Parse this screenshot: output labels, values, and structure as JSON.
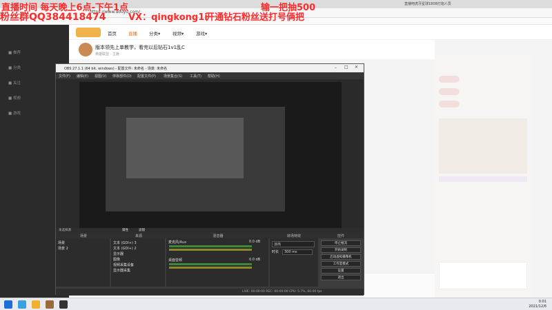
{
  "browser": {
    "url": "https://www.douyu.com/",
    "tab_right_title": "直播吧虎牙星球1808打炮人员"
  },
  "overlays": {
    "line1_left": "直播时间 每天晚上6点-下午1点",
    "line1_right": "输一把抽500",
    "line2_left": "粉丝群QQ384418474",
    "line2_mid": "VX：qingkong1i",
    "line2_right": "开通钻石粉丝送打号俩把"
  },
  "site_nav": {
    "items": [
      "首页",
      "直播",
      "分类▾",
      "视频▾",
      "游戏▾"
    ]
  },
  "stream": {
    "title": "版本领先上单教学，看完以后钻石1v1乱C",
    "subtitle": "英雄联盟 · 主播"
  },
  "obs": {
    "window_title": "OBS 27.1.1 (64 bit, windows) - 配置文件: 未命名 - 场景: 未命名",
    "menu": [
      "文件(F)",
      "编辑(E)",
      "视图(V)",
      "停靠部件(D)",
      "配置文件(P)",
      "场景集合(S)",
      "工具(T)",
      "帮助(H)"
    ],
    "docks": {
      "scenes_header": "场景",
      "sources_header": "来源",
      "mixer_header": "混音器",
      "transitions_header": "转场特效",
      "controls_header": "控件"
    },
    "scenes": [
      "场景",
      "场景 2"
    ],
    "sources": [
      "文本 (GDI+) 3",
      "文本 (GDI+) 2",
      "显示器",
      "图像",
      "视频采集设备",
      "显示器采集"
    ],
    "mixer": [
      {
        "name": "桌面音频",
        "level": "0.0 dB"
      },
      {
        "name": "麦克风/Aux",
        "level": "0.0 dB"
      }
    ],
    "transition": {
      "value": "淡出",
      "duration_label": "时长",
      "duration": "300 ms"
    },
    "controls": [
      "停止推流",
      "开始录制",
      "启动虚拟摄像机",
      "工作室模式",
      "设置",
      "退出"
    ],
    "no_source": "未选择源",
    "props_button": "属性",
    "filters_button": "滤镜",
    "status": "LIVE: 00:00:00   REC: 00:00:00   CPU: 5.7%, 60.00 fps"
  },
  "taskbar": {
    "time": "0:01",
    "date": "2021/12/6"
  }
}
